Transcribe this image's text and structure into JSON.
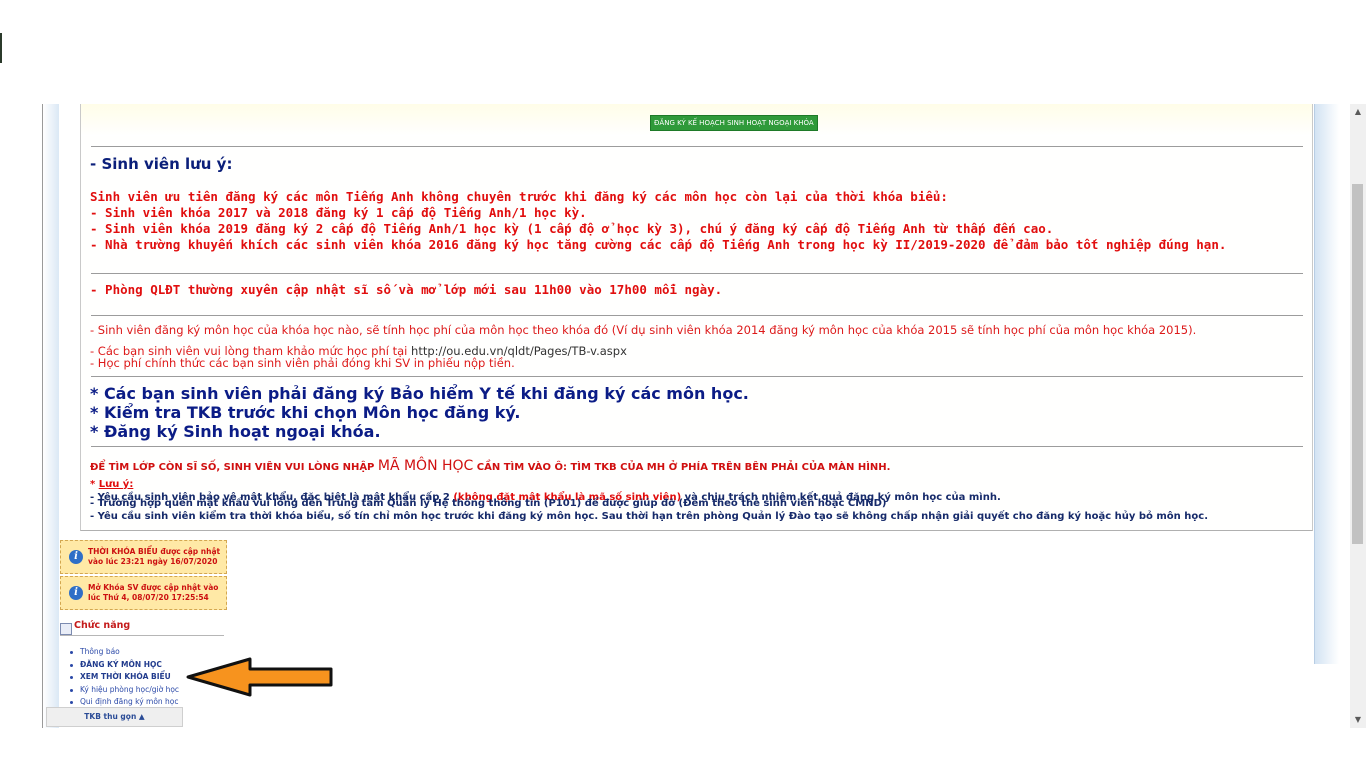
{
  "panel": {
    "register_extracurricular_button": "ĐĂNG KÝ KẾ HOẠCH SINH HOẠT NGOẠI KHÓA",
    "note_heading": "- Sinh viên lưu ý:",
    "english_priority": [
      "Sinh viên ưu tiên đăng ký các môn Tiếng Anh không chuyên trước khi đăng ký các môn học còn lại của thời khóa biểu:",
      "- Sinh viên khóa 2017 và 2018 đăng ký 1 cấp độ Tiếng Anh/1 học kỳ.",
      "- Sinh viên khóa 2019 đăng ký 2 cấp độ Tiếng Anh/1 học kỳ (1 cấp độ ở học kỳ 3), chú ý đăng ký cấp độ Tiếng Anh từ thấp đến cao.",
      "- Nhà trường khuyến khích các sinh viên khóa 2016 đăng ký học tăng cường các cấp độ Tiếng Anh trong học kỳ II/2019-2020 để đảm bảo tốt nghiệp đúng hạn."
    ],
    "qldt_update": "- Phòng QLĐT thường xuyên cập nhật sĩ số và mở lớp mới sau 11h00 vào 17h00 mỗi ngày.",
    "tuition_line1": "- Sinh viên đăng ký môn học của khóa học nào, sẽ tính học phí của môn học theo khóa đó (Ví dụ sinh viên khóa 2014 đăng ký môn học của khóa 2015 sẽ tính học phí của môn học khóa 2015).",
    "tuition_line2_prefix": "- Các bạn sinh viên vui lòng tham khảo mức học phí tại ",
    "tuition_line2_url": "http://ou.edu.vn/qldt/Pages/TB-v.aspx",
    "tuition_line3": "- Học phí chính thức các bạn sinh viên phải đóng khi SV in phiếu nộp tiền.",
    "star_items": [
      "* Các bạn sinh viên phải đăng ký Bảo hiểm Y tế khi đăng ký các môn học.",
      "* Kiểm tra TKB trước khi chọn Môn học đăng ký.",
      "* Đăng ký Sinh hoạt ngoại khóa."
    ],
    "find_class_prefix": "ĐỂ TÌM LỚP CÒN SĨ SỐ, SINH VIÊN VUI LÒNG NHẬP ",
    "find_class_code": "MÃ MÔN HỌC",
    "find_class_suffix": " CẦN TÌM VÀO Ô: TÌM TKB CỦA MH Ở PHÍA TRÊN BÊN PHẢI CỦA MÀN HÌNH.",
    "luu_y_star": "* ",
    "luu_y": "Lưu ý:",
    "password_prefix": "- Yêu cầu sinh viên bảo vệ mật khẩu, đặc biệt là mật khẩu cấp 2 ",
    "password_red": "(không đặt mật khẩu là mã số sinh viên)",
    "password_suffix": " và chịu trách nhiệm kết quả đăng ký môn học của mình.",
    "forgot_password": "- Trường hợp quên mật khẩu vui lòng đến Trung tâm Quản lý Hệ thống thông tin (P101) để được giúp đỡ (Đem theo thẻ sinh viên hoặc CMND)",
    "check_schedule": "- Yêu cầu sinh viên kiểm tra thời khóa biểu, số tín chỉ môn học trước khi đăng ký môn học. Sau thời hạn trên phòng Quản lý Đào tạo sẽ không chấp nhận giải quyết cho đăng ký hoặc hủy bỏ môn học."
  },
  "sidebar": {
    "notice1": "THỜI KHÓA BIỂU được cập nhật vào lúc 23:21 ngày 16/07/2020",
    "notice2": "Mở Khóa SV được cập nhật vào lúc Thứ 4, 08/07/20 17:25:54",
    "functions_title": "Chức năng",
    "menu": [
      "Thông báo",
      "ĐĂNG KÝ MÔN HỌC",
      "XEM THỜI KHÓA BIỂU",
      "Ký hiệu phòng học/giờ học",
      "Qui định đăng ký môn học"
    ],
    "tkb_collapse": "TKB thu gọn",
    "tkb_collapse_icon": "chevron-up-icon"
  },
  "annotation": {
    "arrow_icon": "orange-arrow-left-icon",
    "arrow_color": "#f7931e"
  },
  "colors": {
    "navy": "#0b1f7a",
    "red": "#e10e0e",
    "button_green": "#2f9a3a",
    "notice_bg": "#ffe9a6"
  }
}
